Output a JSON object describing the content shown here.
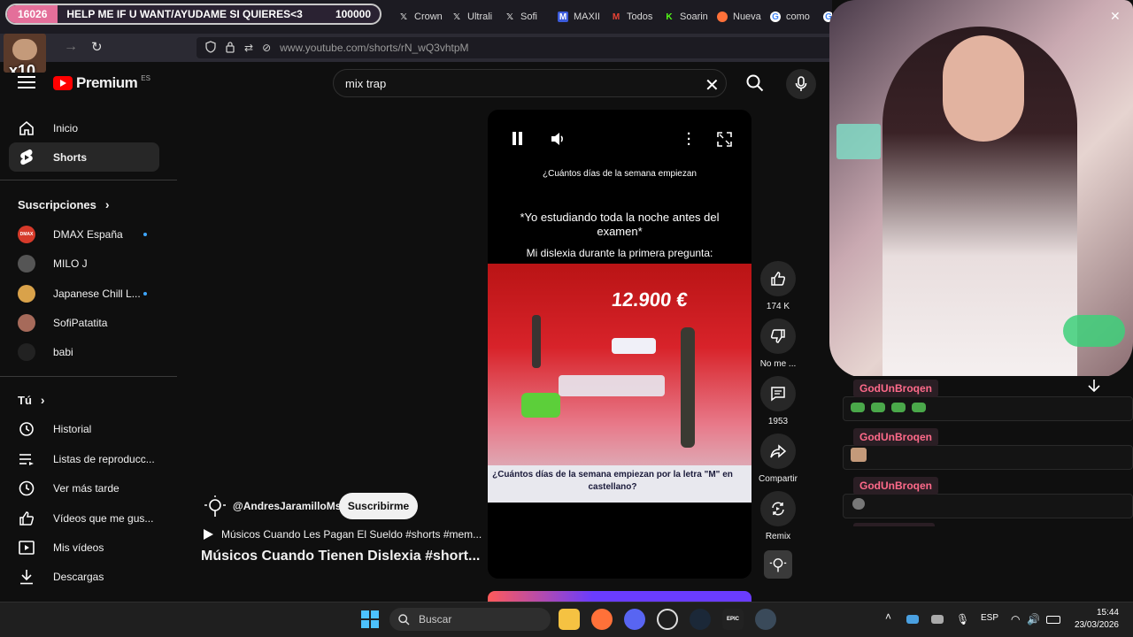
{
  "browser": {
    "overlay": {
      "count": "16026",
      "message": "HELP ME IF U WANT/AYUDAME SI QUIERES<3",
      "goal": "100000"
    },
    "tabs": [
      {
        "label": "Crown",
        "icon": "x-icon"
      },
      {
        "label": "Ultrali",
        "icon": "x-icon"
      },
      {
        "label": "Sofi",
        "icon": "x-icon"
      },
      {
        "label": "MAXII",
        "icon": "maxii-icon"
      },
      {
        "label": "Todos",
        "icon": "gmail-icon"
      },
      {
        "label": "Soarin",
        "icon": "kick-icon"
      },
      {
        "label": "Nueva",
        "icon": "firefox-icon"
      },
      {
        "label": "como",
        "icon": "google-icon"
      }
    ],
    "url": "www.youtube.com/shorts/rN_wQ3vhtpM",
    "overlay_badge": "x10"
  },
  "youtube": {
    "brand": "Premium",
    "country": "ES",
    "search_value": "mix trap",
    "sidebar": {
      "main": [
        {
          "label": "Inicio",
          "icon": "home-icon"
        },
        {
          "label": "Shorts",
          "icon": "shorts-icon"
        }
      ],
      "subs_heading": "Suscripciones",
      "subs": [
        {
          "label": "DMAX España",
          "avatar_text": "DMAX",
          "color": "#d63a2a",
          "live": true
        },
        {
          "label": "MILO J",
          "avatar_text": "",
          "color": "#555555",
          "live": false
        },
        {
          "label": "Japanese Chill L...",
          "avatar_text": "",
          "color": "#d9a24a",
          "live": true
        },
        {
          "label": "SofiPatatita",
          "avatar_text": "",
          "color": "#a66a5a",
          "live": false
        },
        {
          "label": "babi",
          "avatar_text": "",
          "color": "#222222",
          "live": false
        }
      ],
      "you_heading": "Tú",
      "you": [
        {
          "label": "Historial",
          "icon": "history-icon"
        },
        {
          "label": "Listas de reproducc...",
          "icon": "playlist-icon"
        },
        {
          "label": "Ver más tarde",
          "icon": "clock-icon"
        },
        {
          "label": "Vídeos que me gus...",
          "icon": "thumbs-up-icon"
        },
        {
          "label": "Mis vídeos",
          "icon": "video-icon"
        },
        {
          "label": "Descargas",
          "icon": "download-icon"
        }
      ]
    },
    "short": {
      "caption_top": "¿Cuántos días de la semana empiezan",
      "meme_text": "*Yo estudiando toda la noche antes del examen*",
      "meme_sub": "Mi dislexia durante la primera pregunta:",
      "score": "12.900 €",
      "quiz_question": "¿Cuántos días de la semana empiezan por la letra \"M\" en castellano?",
      "channel": "@AndresJaramilloMs",
      "subscribe": "Suscribirme",
      "music": "Músicos Cuando Les Pagan El Sueldo #shorts #mem...",
      "title": "Músicos Cuando Tienen Dislexia #short..."
    },
    "actions": [
      {
        "label": "174 K",
        "icon": "like-icon"
      },
      {
        "label": "No me ...",
        "icon": "dislike-icon"
      },
      {
        "label": "1953",
        "icon": "comment-icon"
      },
      {
        "label": "Compartir",
        "icon": "share-icon"
      },
      {
        "label": "Remix",
        "icon": "remix-icon"
      }
    ]
  },
  "stream": {
    "chat": [
      {
        "user": "GodUnBroqen",
        "content": "frog emotes"
      },
      {
        "user": "GodUnBroqen",
        "content": "face emote"
      },
      {
        "user": "GodUnBroqen",
        "content": "emote"
      }
    ]
  },
  "taskbar": {
    "search_placeholder": "Buscar",
    "lang": "ESP",
    "time": "15:44",
    "date": "23/03/2026"
  }
}
